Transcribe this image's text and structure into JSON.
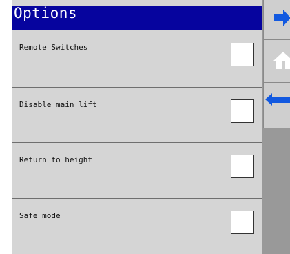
{
  "title": "Options",
  "options": [
    {
      "label": "Remote Switches",
      "checked": false
    },
    {
      "label": "Disable main lift",
      "checked": false
    },
    {
      "label": "Return to height",
      "checked": false
    },
    {
      "label": "Safe mode",
      "checked": false
    }
  ],
  "sidebar": {
    "buttons": [
      {
        "icon": "arrow-right-icon"
      },
      {
        "icon": "home-icon"
      },
      {
        "icon": "arrow-left-icon"
      }
    ]
  },
  "colors": {
    "title_bar": "#06049e",
    "title_text": "#ffffff",
    "panel": "#d5d5d5",
    "sidebar": "#999999",
    "sidebar_button": "#cfcfcf",
    "arrow_icon": "#1259e0",
    "home_icon": "#ffffff"
  }
}
